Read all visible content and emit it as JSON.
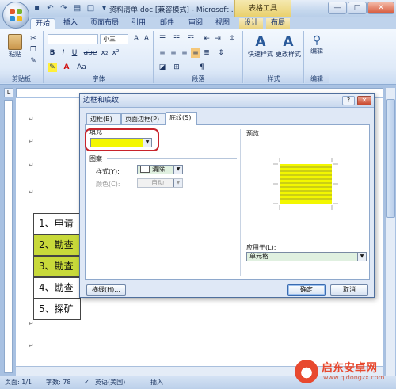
{
  "window": {
    "title": "资料清单.doc [兼容模式] - Microsoft ...",
    "context_tools": "表格工具",
    "controls": [
      "—",
      "□",
      "✕"
    ]
  },
  "ribbon": {
    "tabs": [
      "开始",
      "插入",
      "页面布局",
      "引用",
      "邮件",
      "审阅",
      "视图",
      "设计",
      "布局"
    ],
    "active_tab": "开始",
    "groups": {
      "clipboard": {
        "label": "剪贴板",
        "paste": "粘贴"
      },
      "font": {
        "label": "字体",
        "size": "小三",
        "buttons": [
          "B",
          "I",
          "U",
          "abe",
          "x₂",
          "x²",
          "A",
          "Aa"
        ]
      },
      "paragraph": {
        "label": "段落"
      },
      "styles": {
        "label": "样式",
        "quick_styles": "快速样式",
        "change_styles": "更改样式"
      },
      "editing": {
        "label": "编辑",
        "button": "编辑"
      }
    }
  },
  "document": {
    "rows": [
      {
        "text": "1、申请",
        "highlight": false
      },
      {
        "text": "2、勘查",
        "highlight": true
      },
      {
        "text": "3、勘查",
        "highlight": true
      },
      {
        "text": "4、勘查",
        "highlight": false
      },
      {
        "text": "5、探矿",
        "highlight": false
      }
    ],
    "para_mark": "↵"
  },
  "dialog": {
    "title": "边框和底纹",
    "help": "?",
    "close": "✕",
    "tabs": [
      "边框(B)",
      "页面边框(P)",
      "底纹(S)"
    ],
    "active_tab": "底纹(S)",
    "fill": {
      "label": "填充",
      "color": "#f3f700"
    },
    "pattern": {
      "section": "图案",
      "style_label": "样式(Y):",
      "style_value": "清除",
      "color_label": "颜色(C):",
      "color_value": "自动"
    },
    "preview": {
      "label": "预览"
    },
    "apply_to": {
      "label": "应用于(L):",
      "value": "单元格"
    },
    "buttons": {
      "lines": "横线(H)...",
      "ok": "确定",
      "cancel": "取消"
    }
  },
  "status_bar": {
    "page": "页面: 1/1",
    "words": "字数: 78",
    "language": "英语(美国)",
    "mode": "插入"
  },
  "watermark": {
    "text": "启东安卓网",
    "url": "www.qidongzx.com"
  },
  "colors": {
    "accent": "#c8232b",
    "fill_yellow": "#f3f700",
    "row_highlight": "#c8d93a"
  }
}
